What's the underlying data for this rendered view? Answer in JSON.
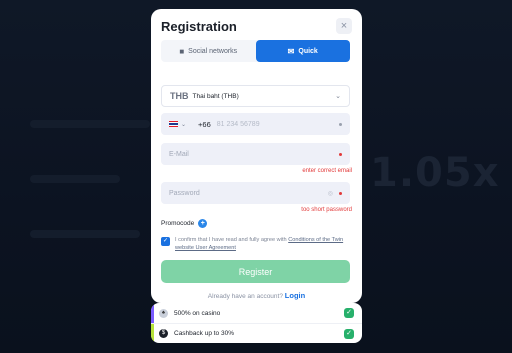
{
  "background": {
    "big_text": "1.05x"
  },
  "modal": {
    "title": "Registration",
    "close_icon": "×",
    "tabs": [
      {
        "label": "Social networks",
        "icon": "users-icon",
        "active": false
      },
      {
        "label": "Quick",
        "icon": "envelope-icon",
        "active": true
      }
    ],
    "currency": {
      "code": "THB",
      "name": "Thai baht (THB)"
    },
    "phone": {
      "prefix": "+66",
      "placeholder": "81 234 56789"
    },
    "email": {
      "placeholder": "E-Mail",
      "error": "enter correct email"
    },
    "password": {
      "placeholder": "Password",
      "error": "too short password"
    },
    "promocode_label": "Promocode",
    "agreement": {
      "text": "I confirm that I have read and fully agree with ",
      "link": "Conditions of the Twin website User Agreement"
    },
    "register_label": "Register",
    "login_prompt": "Already have an account?",
    "login_link": "Login"
  },
  "bonuses": [
    {
      "label": "500% on casino",
      "color": "#7a5cff"
    },
    {
      "label": "Cashback up to 30%",
      "color": "#b6e23a"
    }
  ],
  "colors": {
    "accent": "#1a71e0",
    "register": "#7fd3a6",
    "error": "#e23a3a",
    "ok": "#27b06b"
  }
}
